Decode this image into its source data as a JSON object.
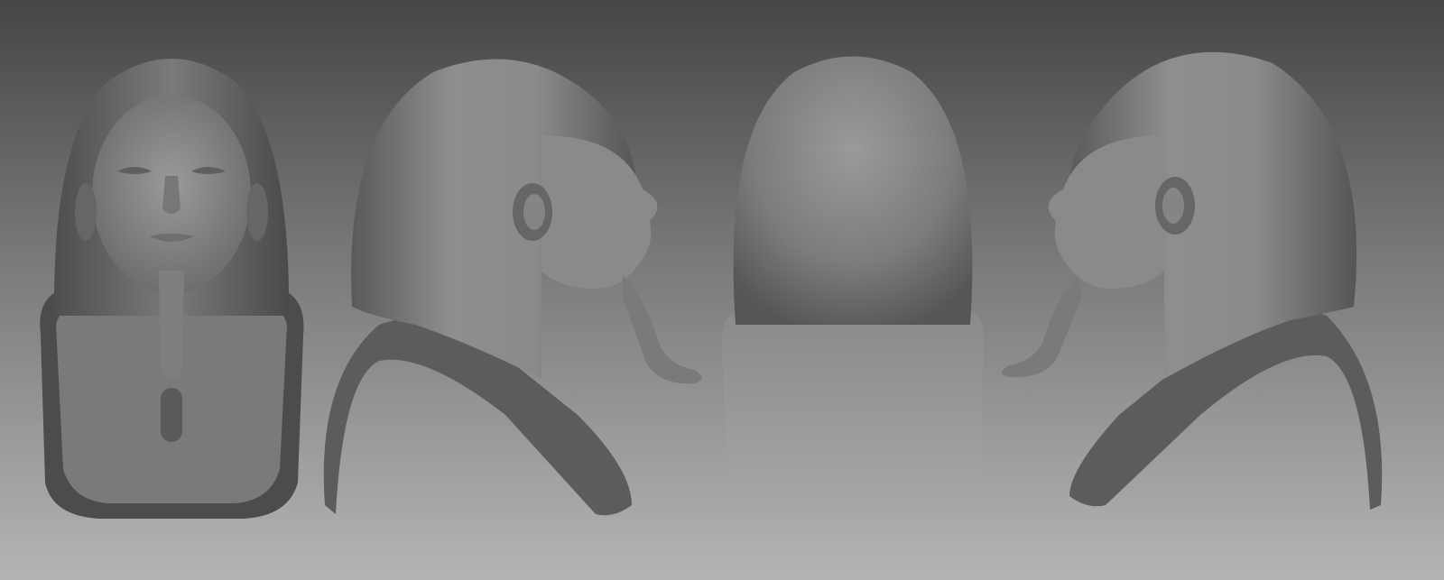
{
  "scene": {
    "views": [
      {
        "view": "front"
      },
      {
        "view": "right-profile"
      },
      {
        "view": "back"
      },
      {
        "view": "left-profile"
      }
    ]
  }
}
